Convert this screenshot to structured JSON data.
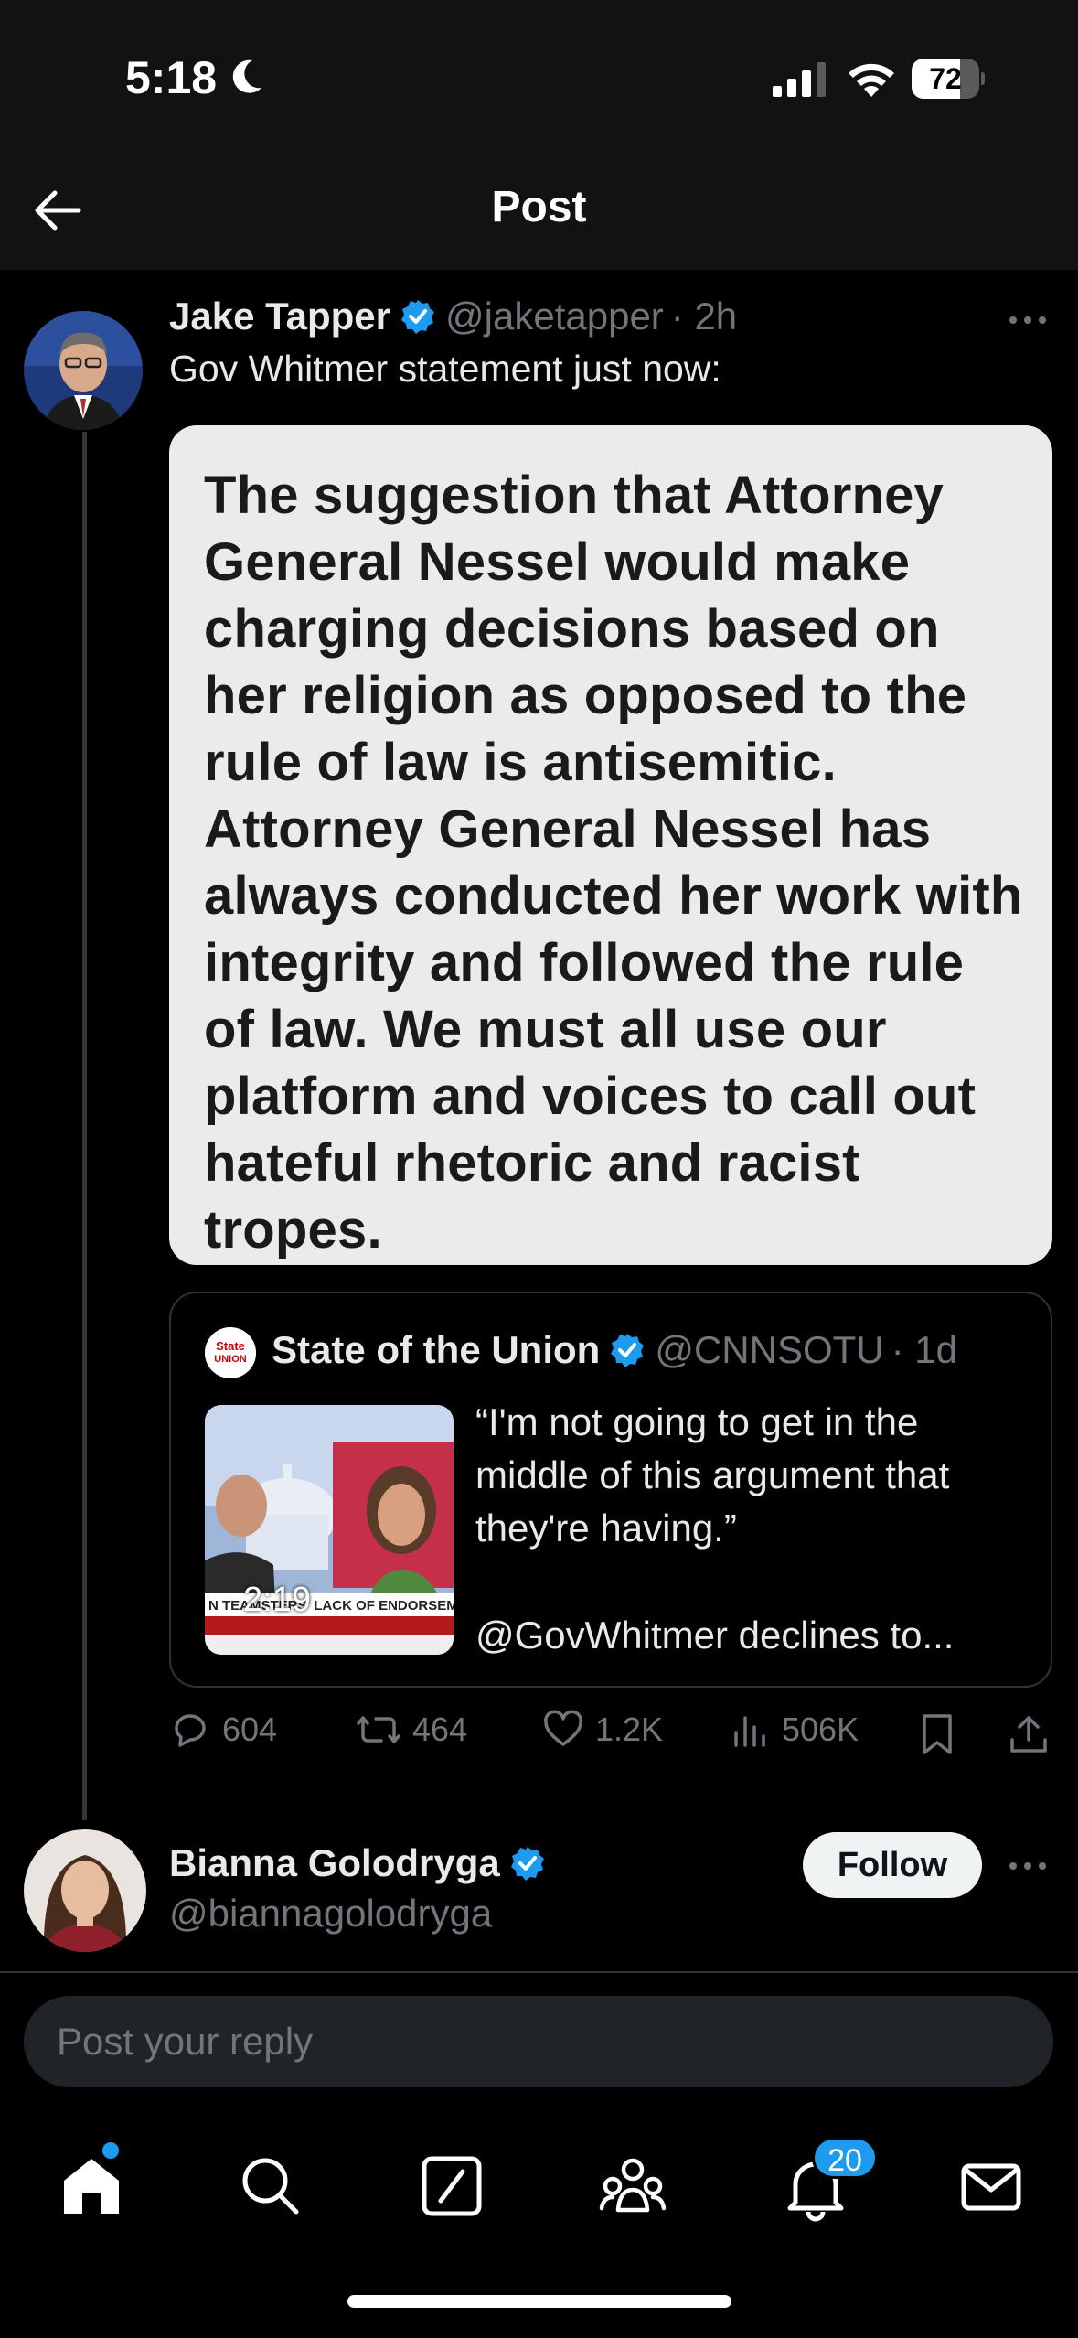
{
  "status_bar": {
    "time": "5:18",
    "battery": "72",
    "battery_level": 0.72
  },
  "header": {
    "title": "Post"
  },
  "tweet": {
    "author": "Jake Tapper",
    "handle": "@jaketapper",
    "time": "· 2h",
    "text": "Gov Whitmer statement just now:",
    "statement": "The suggestion that Attorney General Nessel would make charging decisions based on her religion as opposed to the rule of law is antisemitic. Attorney General Nessel has always conducted her work with integrity and followed the rule of law. We must all use our platform and voices to call out hateful rhetoric and racist tropes.",
    "quote": {
      "author": "State of the Union",
      "handle": "@CNNSOTU",
      "time": "· 1d",
      "text": "“I'm not going to get in the middle of this argument that they're having.”",
      "text2": "@GovWhitmer declines to...",
      "video_duration": "2:19",
      "avatar_text": "State of the Union"
    },
    "stats": {
      "replies": "604",
      "reposts": "464",
      "likes": "1.2K",
      "views": "506K"
    }
  },
  "reply_user": {
    "name": "Bianna Golodryga",
    "handle": "@biannagolodryga",
    "follow_label": "Follow"
  },
  "reply_box": {
    "placeholder": "Post your reply"
  },
  "tab_bar": {
    "notifications_badge": "20",
    "icons": [
      "home-icon",
      "search-icon",
      "grok-icon",
      "communities-icon",
      "notifications-icon",
      "messages-icon"
    ]
  },
  "colors": {
    "accent": "#1d9bf0",
    "background": "#000000",
    "muted": "#71767b"
  }
}
